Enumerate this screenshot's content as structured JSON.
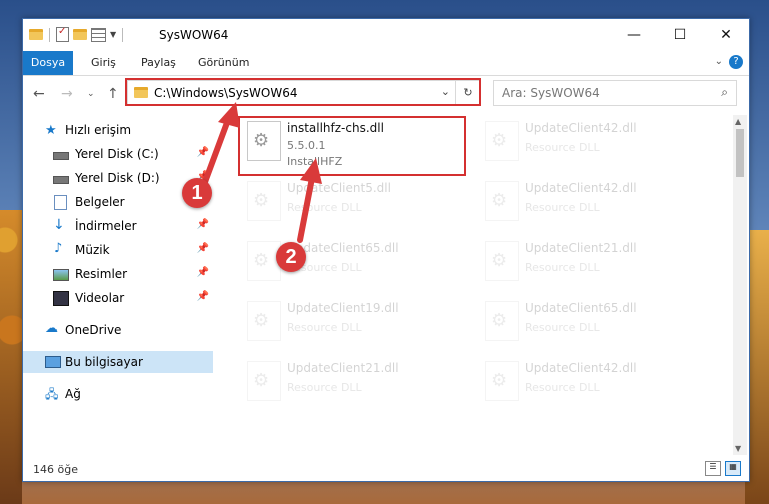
{
  "window": {
    "title": "SysWOW64"
  },
  "ribbon": {
    "tabs": [
      "Dosya",
      "Giriş",
      "Paylaş",
      "Görünüm"
    ]
  },
  "caption": {
    "minimize": "—",
    "maximize": "☐",
    "close": "✕"
  },
  "address": {
    "path": "C:\\Windows\\SysWOW64"
  },
  "search": {
    "placeholder": "Ara: SysWOW64"
  },
  "sidebar": {
    "quick_access": "Hızlı erişim",
    "items": [
      {
        "label": "Yerel Disk (C:)",
        "icon": "drive-icon"
      },
      {
        "label": "Yerel Disk (D:)",
        "icon": "drive-icon"
      },
      {
        "label": "Belgeler",
        "icon": "documents-icon"
      },
      {
        "label": "İndirmeler",
        "icon": "download-icon"
      },
      {
        "label": "Müzik",
        "icon": "music-icon"
      },
      {
        "label": "Resimler",
        "icon": "pictures-icon"
      },
      {
        "label": "Videolar",
        "icon": "videos-icon"
      }
    ],
    "onedrive": "OneDrive",
    "this_pc": "Bu bilgisayar",
    "network": "Ağ"
  },
  "files": {
    "selected": {
      "name": "installhfz-chs.dll",
      "version": "5.5.0.1",
      "type": "InstallHFZ"
    },
    "background": [
      {
        "name": "UpdateClient42.dll",
        "type": "Resource DLL"
      },
      {
        "name": "UpdateClient5.dll",
        "type": "Resource DLL"
      },
      {
        "name": "UpdateClient42.dll",
        "type": "Resource DLL"
      },
      {
        "name": "UpdateClient65.dll",
        "type": "Resource DLL"
      },
      {
        "name": "UpdateClient21.dll",
        "type": "Resource DLL"
      },
      {
        "name": "UpdateClient19.dll",
        "type": "Resource DLL"
      },
      {
        "name": "UpdateClient65.dll",
        "type": "Resource DLL"
      },
      {
        "name": "UpdateClient21.dll",
        "type": "Resource DLL"
      },
      {
        "name": "UpdateClient42.dll",
        "type": "Resource DLL"
      }
    ]
  },
  "status": {
    "count": "146 öğe"
  },
  "callouts": {
    "one": "1",
    "two": "2"
  },
  "colors": {
    "accent": "#1979ca",
    "highlight": "#d43030",
    "selection": "#cce4f7"
  }
}
